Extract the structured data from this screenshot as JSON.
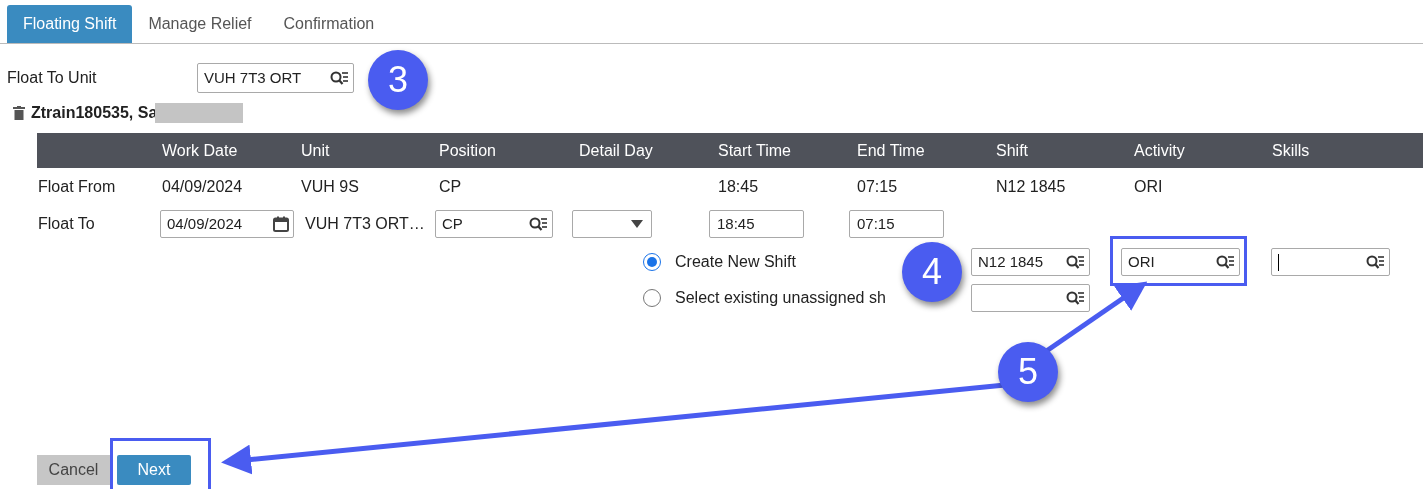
{
  "tabs": [
    {
      "label": "Floating Shift",
      "selected": true
    },
    {
      "label": "Manage Relief",
      "selected": false
    },
    {
      "label": "Confirmation",
      "selected": false
    }
  ],
  "float_to_unit": {
    "label": "Float To Unit",
    "value": "VUH 7T3 ORT"
  },
  "employee": {
    "name": "Ztrain180535, Sa",
    "redacted": true
  },
  "table": {
    "columns": [
      "",
      "Work Date",
      "Unit",
      "Position",
      "Detail Day",
      "Start Time",
      "End Time",
      "Shift",
      "Activity",
      "Skills"
    ],
    "float_from": {
      "label": "Float From",
      "work_date": "04/09/2024",
      "unit": "VUH 9S",
      "position": "CP",
      "start_time": "18:45",
      "end_time": "07:15",
      "shift": "N12 1845",
      "activity": "ORI"
    },
    "float_to": {
      "label": "Float To",
      "work_date": "04/09/2024",
      "unit": "VUH 7T3 ORT…",
      "position": "CP",
      "start_time": "18:45",
      "end_time": "07:15"
    }
  },
  "shift_options": [
    {
      "label": "Create New Shift",
      "selected": true,
      "shift": "N12 1845",
      "activity": "ORI"
    },
    {
      "label": "Select existing unassigned sh",
      "selected": false
    }
  ],
  "buttons": {
    "cancel": "Cancel",
    "next": "Next"
  },
  "annotations": [
    {
      "number": "3"
    },
    {
      "number": "4"
    },
    {
      "number": "5"
    }
  ]
}
